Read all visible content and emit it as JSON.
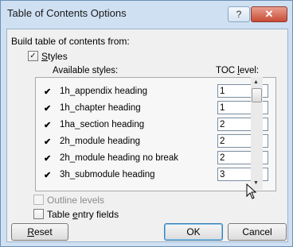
{
  "window": {
    "title": "Table of Contents Options",
    "help_label": "?",
    "close_label": "✕"
  },
  "build_from_label": "Build table of contents from:",
  "styles_checkbox": {
    "prefix": "",
    "underlined": "S",
    "rest": "tyles",
    "checked": true
  },
  "columns": {
    "available_styles": "Available styles:",
    "toc_level_prefix": "TOC ",
    "toc_level_underlined": "l",
    "toc_level_rest": "evel:"
  },
  "styles": [
    {
      "name": "1h_appendix heading",
      "level": "1"
    },
    {
      "name": "1h_chapter heading",
      "level": "1"
    },
    {
      "name": "1ha_section heading",
      "level": "2"
    },
    {
      "name": "2h_module heading",
      "level": "2"
    },
    {
      "name": "2h_module heading no break",
      "level": "2"
    },
    {
      "name": "3h_submodule heading",
      "level": "3"
    }
  ],
  "outline_levels": {
    "label": "Outline levels",
    "checked": false,
    "disabled": true
  },
  "table_entry_fields": {
    "prefix": "Table ",
    "underlined": "e",
    "rest": "ntry fields",
    "checked": false
  },
  "buttons": {
    "reset_underlined": "R",
    "reset_rest": "eset",
    "ok": "OK",
    "cancel": "Cancel"
  }
}
